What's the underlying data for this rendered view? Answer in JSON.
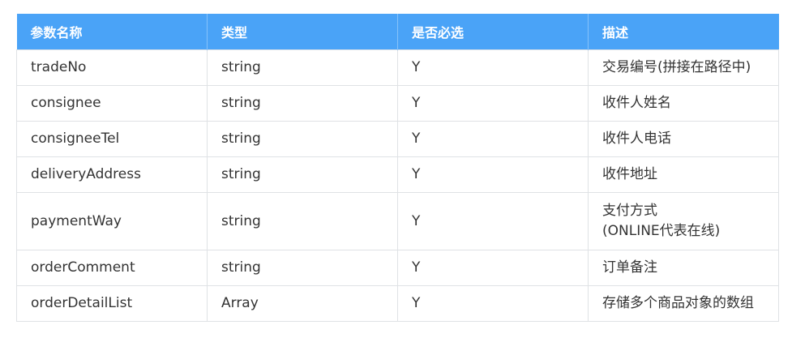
{
  "table": {
    "headers": [
      "参数名称",
      "类型",
      "是否必选",
      "描述"
    ],
    "rows": [
      [
        "tradeNo",
        "string",
        "Y",
        "交易编号(拼接在路径中)"
      ],
      [
        "consignee",
        "string",
        "Y",
        "收件人姓名"
      ],
      [
        "consigneeTel",
        "string",
        "Y",
        "收件人电话"
      ],
      [
        "deliveryAddress",
        "string",
        "Y",
        "收件地址"
      ],
      [
        "paymentWay",
        "string",
        "Y",
        "支付方式",
        "(ONLINE代表在线)"
      ],
      [
        "orderComment",
        "string",
        "Y",
        "订单备注"
      ],
      [
        "orderDetailList",
        "Array",
        "Y",
        "存储多个商品对象的数组"
      ]
    ]
  }
}
